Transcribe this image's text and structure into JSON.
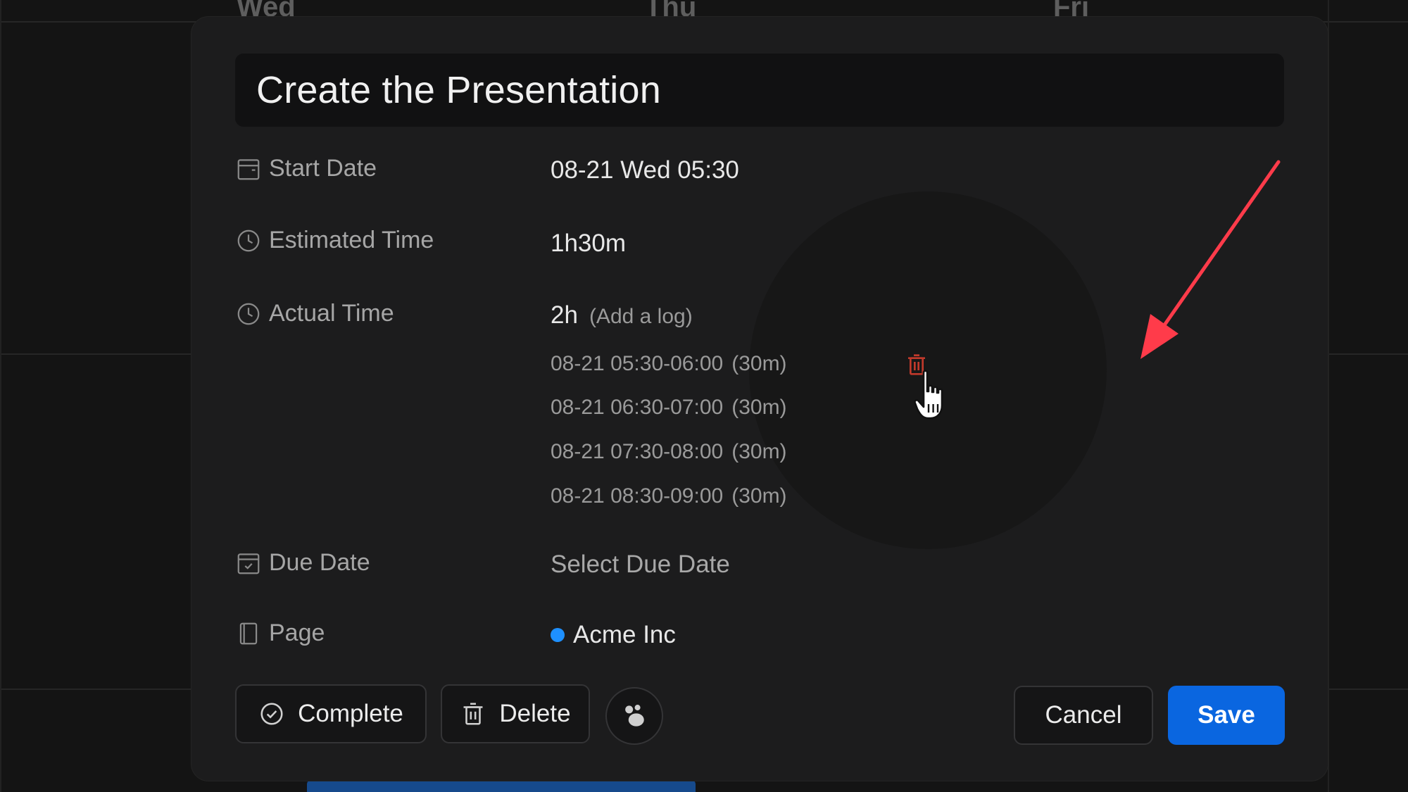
{
  "calendar": {
    "day_headers": [
      "Wed",
      "Thu",
      "Fri"
    ]
  },
  "modal": {
    "title": "Create the Presentation",
    "fields": {
      "start_date": {
        "label": "Start Date",
        "value": "08-21 Wed 05:30"
      },
      "estimated_time": {
        "label": "Estimated Time",
        "value": "1h30m"
      },
      "actual_time": {
        "label": "Actual Time",
        "value": "2h",
        "add_log": "(Add a log)",
        "logs": [
          {
            "range": "08-21 05:30-06:00",
            "duration": "(30m)"
          },
          {
            "range": "08-21 06:30-07:00",
            "duration": "(30m)"
          },
          {
            "range": "08-21 07:30-08:00",
            "duration": "(30m)"
          },
          {
            "range": "08-21 08:30-09:00",
            "duration": "(30m)"
          }
        ]
      },
      "due_date": {
        "label": "Due Date",
        "placeholder": "Select Due Date"
      },
      "page": {
        "label": "Page",
        "value": "Acme Inc",
        "dot_color": "#1e90ff"
      }
    },
    "buttons": {
      "complete": "Complete",
      "delete": "Delete",
      "cancel": "Cancel",
      "save": "Save"
    }
  },
  "colors": {
    "accent": "#0a66e0",
    "danger": "#c0392b",
    "annotation_arrow": "#ff3b4a"
  },
  "icons": [
    "calendar-icon",
    "clock-icon",
    "calendar-check-icon",
    "page-icon",
    "check-circle-icon",
    "trash-icon",
    "paw-icon",
    "hand-cursor-icon"
  ]
}
